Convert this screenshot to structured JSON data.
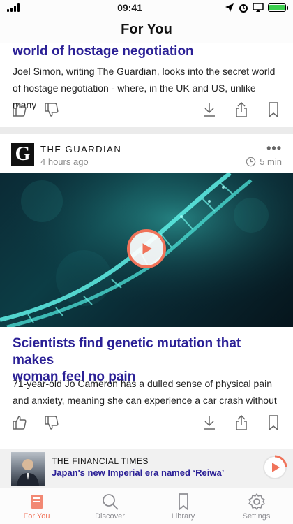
{
  "status_bar": {
    "time": "09:41"
  },
  "nav": {
    "title": "For You"
  },
  "cards": [
    {
      "headline": "world of hostage negotiation",
      "summary_line1": "Joel Simon, writing The Guardian, looks into the secret world",
      "summary_line2": "of hostage negotiation - where, in the UK and US, unlike many"
    },
    {
      "source": "THE GUARDIAN",
      "logo_letter": "G",
      "time_ago": "4 hours ago",
      "read_time": "5 min",
      "more": "•••",
      "headline_line1": "Scientists find genetic mutation that makes",
      "headline_line2": "woman feel no pain",
      "summary_line1": "71-year-old Jo Cameron has a dulled sense of physical pain",
      "summary_line2": "and anxiety, meaning she can experience a car crash without"
    }
  ],
  "mini_player": {
    "source": "THE FINANCIAL TIMES",
    "title": "Japan's new Imperial era named ‘Reiwa’"
  },
  "tabs": [
    {
      "label": "For You",
      "icon": "news-icon",
      "active": true
    },
    {
      "label": "Discover",
      "icon": "search-icon",
      "active": false
    },
    {
      "label": "Library",
      "icon": "bookmark-icon",
      "active": false
    },
    {
      "label": "Settings",
      "icon": "gear-icon",
      "active": false
    }
  ],
  "colors": {
    "accent": "#f0735a",
    "headline": "#2b2096",
    "battery": "#3ccf4e"
  }
}
